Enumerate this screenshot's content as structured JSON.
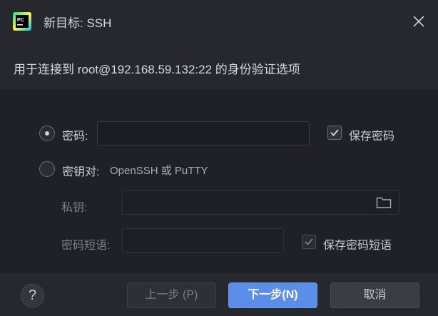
{
  "window": {
    "title": "新目标: SSH",
    "app_icon": "pycharm-icon",
    "close_icon": "close-icon"
  },
  "subtitle": "用于连接到 root@192.168.59.132:22 的身份验证选项",
  "auth": {
    "password_option": {
      "label": "密码:",
      "selected": true,
      "value": ""
    },
    "save_password": {
      "label": "保存密码",
      "checked": true
    },
    "keypair_option": {
      "label": "密钥对:",
      "hint": "OpenSSH 或 PuTTY",
      "selected": false
    },
    "private_key": {
      "label": "私钥:",
      "value": "",
      "browse_icon": "folder-icon"
    },
    "passphrase": {
      "label": "密码短语:",
      "value": ""
    },
    "save_passphrase": {
      "label": "保存密码短语",
      "checked": true
    }
  },
  "footer": {
    "help_label": "?",
    "prev_label": "上一步 (P)",
    "next_label": "下一步(N)",
    "cancel_label": "取消"
  },
  "colors": {
    "background": "#1f2127",
    "header": "#26282e",
    "accent": "#5a8ee8"
  }
}
